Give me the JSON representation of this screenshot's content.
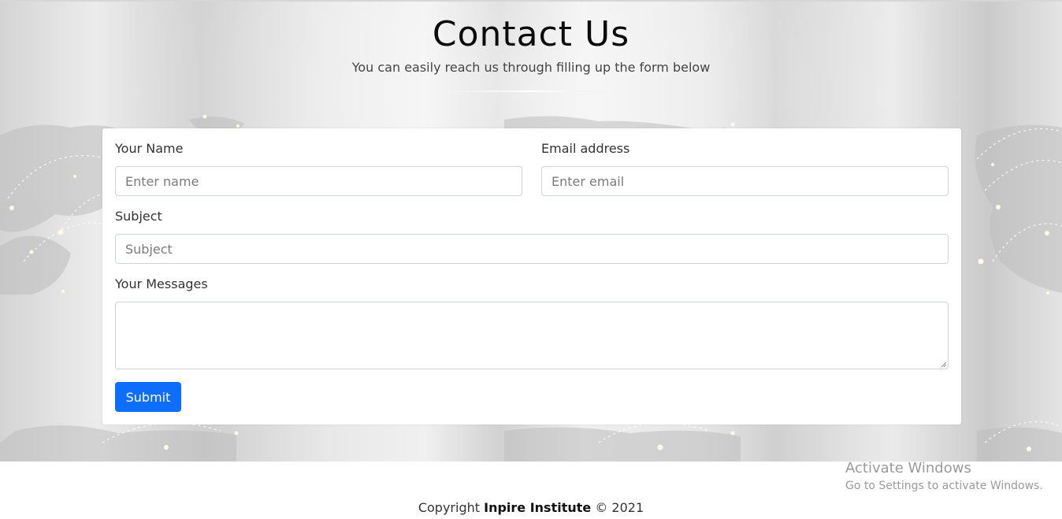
{
  "header": {
    "title": "Contact Us",
    "subtitle": "You can easily reach us through filling up the form below"
  },
  "form": {
    "name_label": "Your Name",
    "name_placeholder": "Enter name",
    "email_label": "Email address",
    "email_placeholder": "Enter email",
    "subject_label": "Subject",
    "subject_placeholder": "Subject",
    "message_label": "Your Messages",
    "submit_label": "Submit"
  },
  "footer": {
    "copyright_prefix": "Copyright",
    "brand": "Inpire Institute",
    "copyright_suffix": "© 2021"
  },
  "watermark": {
    "title": "Activate Windows",
    "subtitle": "Go to Settings to activate Windows."
  },
  "colors": {
    "primary_button": "#0d6efd",
    "card_background": "#ffffff",
    "hero_background": "#e4e4e4"
  }
}
